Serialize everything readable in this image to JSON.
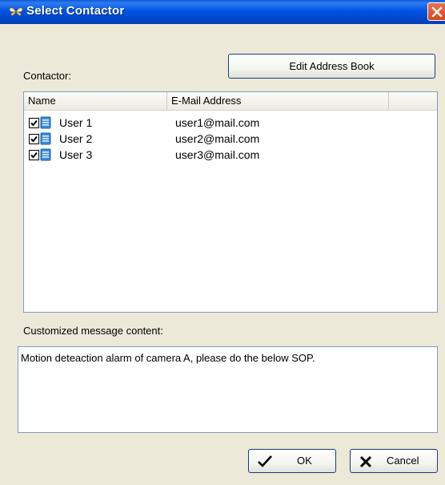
{
  "window": {
    "title": "Select Contactor",
    "icon": "butterfly-icon",
    "close_icon": "close-icon"
  },
  "contactor_label": "Contactor:",
  "edit_address_book_label": "Edit Address Book",
  "list": {
    "columns": [
      "Name",
      "E-Mail Address"
    ],
    "rows": [
      {
        "checked": true,
        "name": "User 1",
        "email": "user1@mail.com"
      },
      {
        "checked": true,
        "name": "User 2",
        "email": "user2@mail.com"
      },
      {
        "checked": true,
        "name": "User 3",
        "email": "user3@mail.com"
      }
    ]
  },
  "message_label": "Customized message content:",
  "message_value": "Motion deteaction alarm of camera A, please do the below SOP.",
  "ok_label": "OK",
  "cancel_label": "Cancel",
  "colors": {
    "titlebar": "#0054e3",
    "dialog_bg": "#ece9d8",
    "close_button": "#d9441d",
    "border": "#7f9db9"
  }
}
